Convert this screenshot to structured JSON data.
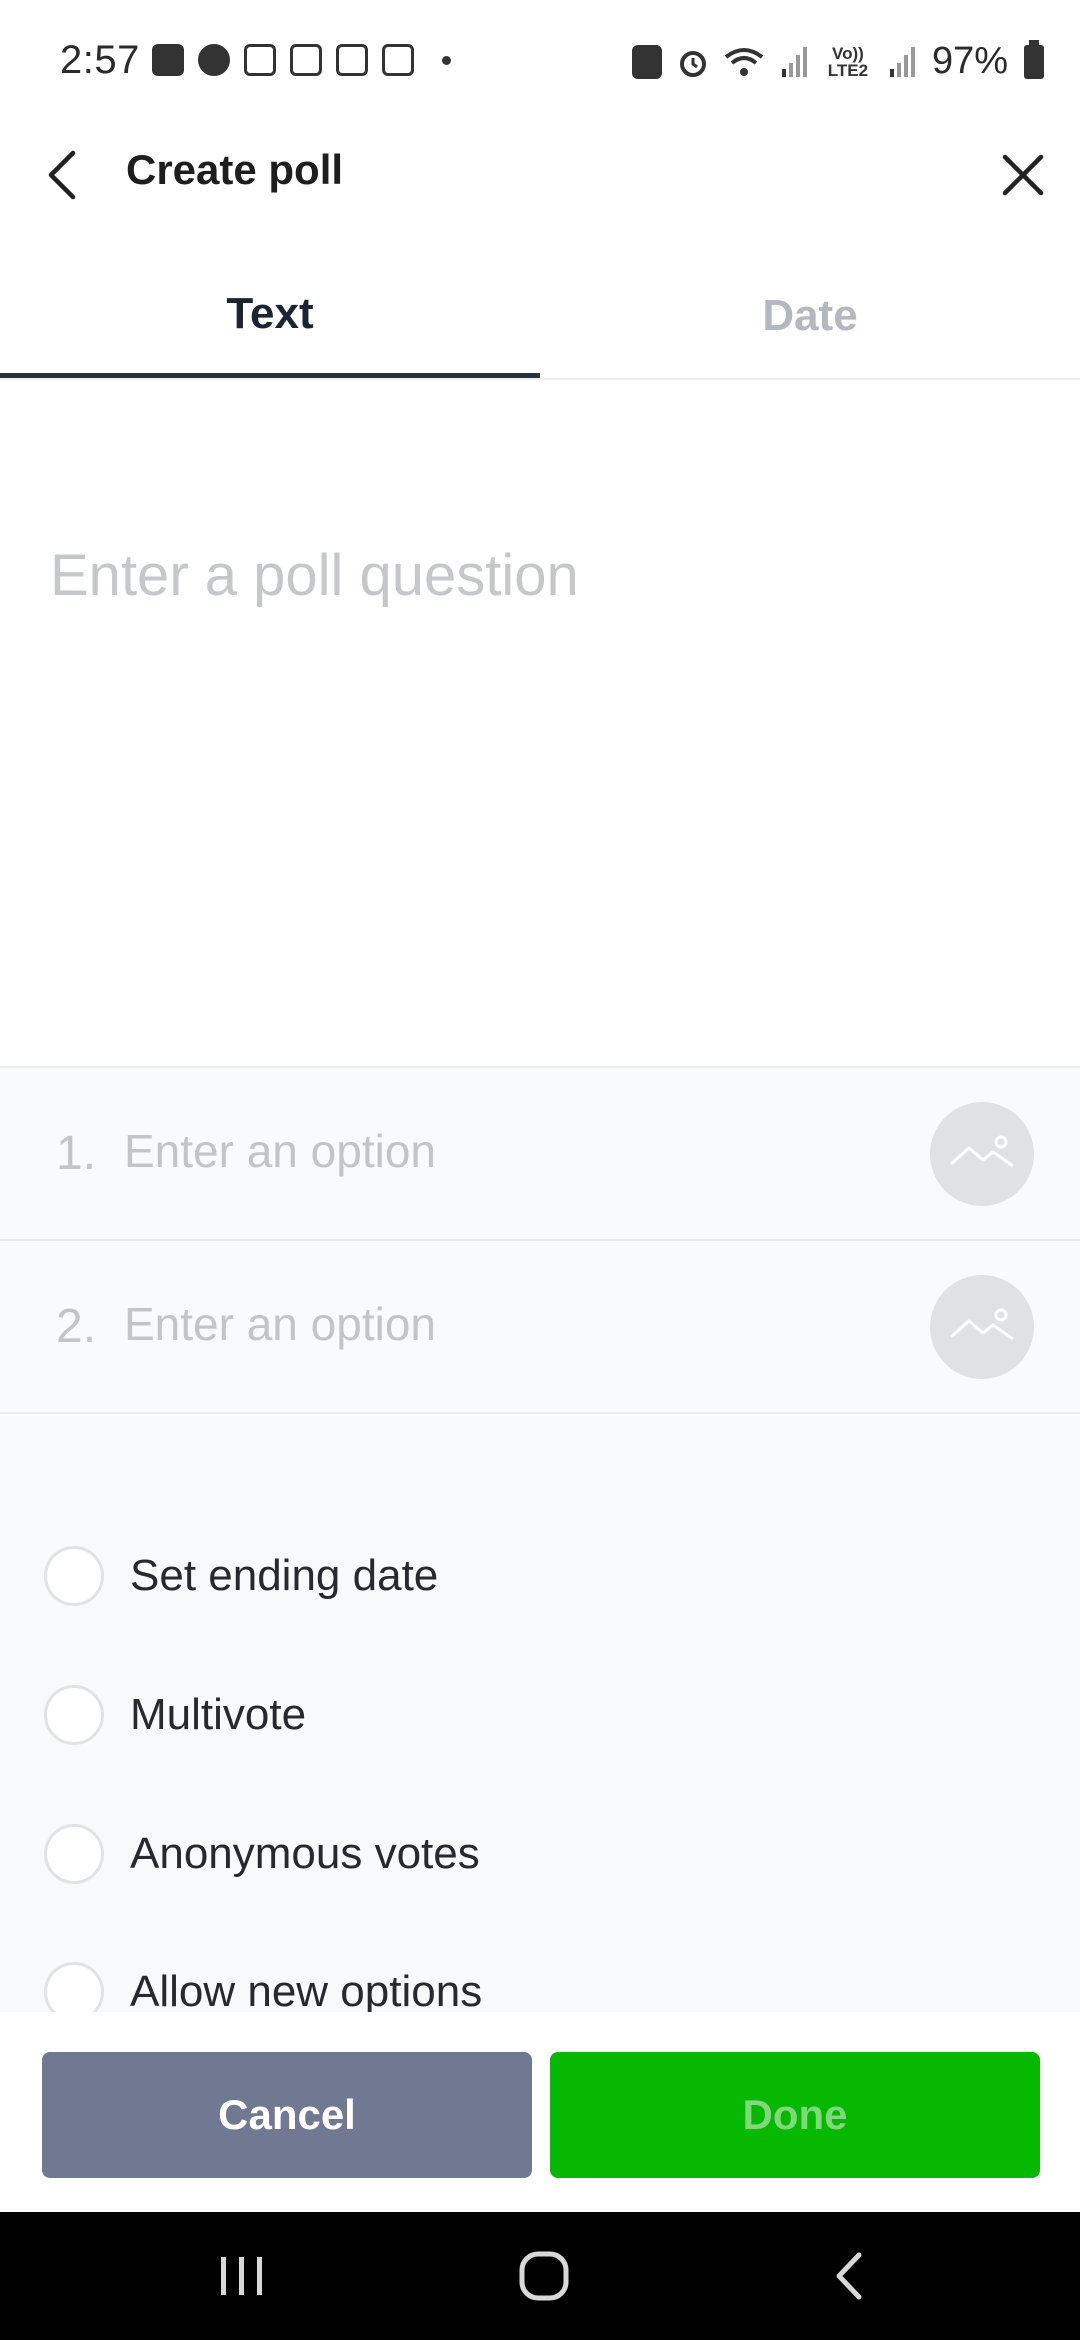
{
  "status_bar": {
    "time": "2:57",
    "battery_text": "97%",
    "volte_text": "Vo)) LTE2",
    "icons_left": [
      "message-icon",
      "line-icon",
      "app-icon",
      "app-icon",
      "app-icon",
      "app-icon",
      "dot-icon"
    ],
    "icons_right": [
      "vpn-icon",
      "alarm-icon",
      "wifi-icon",
      "signal-icon",
      "volte-icon",
      "signal-icon",
      "battery-icon"
    ]
  },
  "header": {
    "title": "Create poll",
    "back_icon": "chevron-left-icon",
    "close_icon": "close-icon"
  },
  "tabs": [
    {
      "label": "Text",
      "active": true
    },
    {
      "label": "Date",
      "active": false
    }
  ],
  "question": {
    "placeholder": "Enter a poll question",
    "value": ""
  },
  "options": [
    {
      "number": "1.",
      "placeholder": "Enter an option",
      "value": "",
      "image_icon": "image-icon"
    },
    {
      "number": "2.",
      "placeholder": "Enter an option",
      "value": "",
      "image_icon": "image-icon"
    }
  ],
  "settings": [
    {
      "label": "Set ending date",
      "checked": false
    },
    {
      "label": "Multivote",
      "checked": false
    },
    {
      "label": "Anonymous votes",
      "checked": false
    },
    {
      "label": "Allow new options",
      "checked": false
    }
  ],
  "footer": {
    "cancel_label": "Cancel",
    "done_label": "Done"
  },
  "colors": {
    "done_green": "#06b800",
    "cancel_gray": "#717992",
    "active_tab": "#1c2431",
    "inactive_tab": "#b4b8be"
  }
}
